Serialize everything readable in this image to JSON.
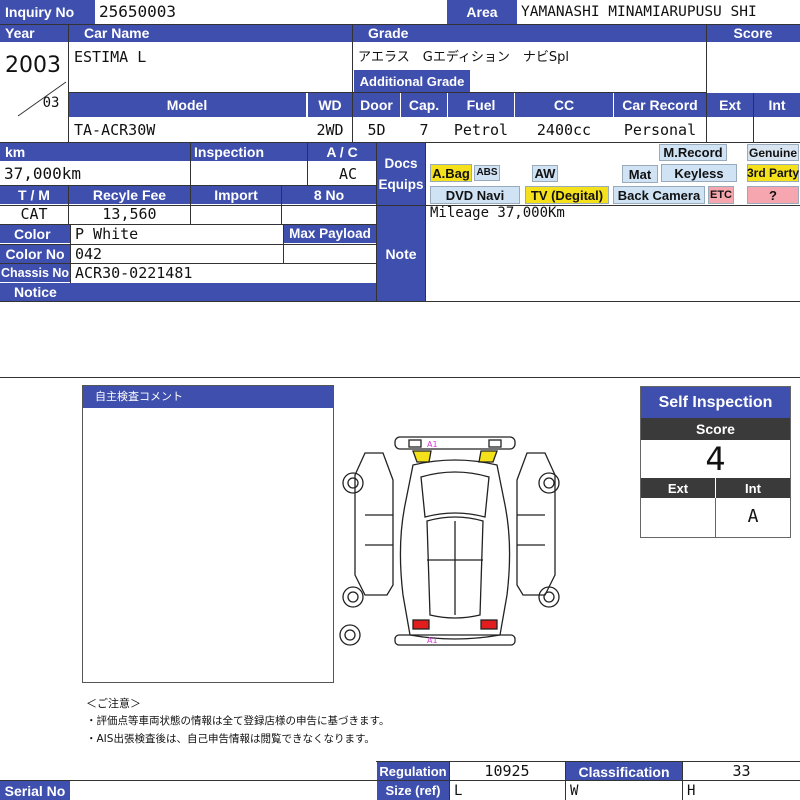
{
  "inquiry": {
    "label": "Inquiry No",
    "value": "25650003"
  },
  "area": {
    "label": "Area",
    "value": "YAMANASHI MINAMIARUPUSU SHI"
  },
  "year": {
    "label": "Year",
    "value": "2003",
    "month": "03"
  },
  "car_name": {
    "label": "Car Name",
    "value": "ESTIMA L"
  },
  "grade": {
    "label": "Grade",
    "value": "アエラス　Gエディション　ナビSpl",
    "additional_label": "Additional Grade",
    "additional_value": ""
  },
  "score_header": {
    "label": "Score"
  },
  "model": {
    "label": "Model",
    "value": "TA-ACR30W"
  },
  "wd": {
    "label": "WD",
    "value": "2WD"
  },
  "door": {
    "label": "Door",
    "value": "5D"
  },
  "cap": {
    "label": "Cap.",
    "value": "7"
  },
  "fuel": {
    "label": "Fuel",
    "value": "Petrol"
  },
  "cc": {
    "label": "CC",
    "value": "2400cc"
  },
  "car_record": {
    "label": "Car Record",
    "value": "Personal"
  },
  "ext_header": {
    "label": "Ext",
    "value": ""
  },
  "int_header": {
    "label": "Int",
    "value": ""
  },
  "km": {
    "label": "km",
    "value": "37,000km"
  },
  "inspection": {
    "label": "Inspection",
    "value": ""
  },
  "ac": {
    "label": "A / C",
    "value": "AC"
  },
  "docs": {
    "label_1": "Docs",
    "label_2": "Equips"
  },
  "equips": {
    "abag": "A.Bag",
    "abs": "ABS",
    "aw": "AW",
    "mrecord": "M.Record",
    "genuine": "Genuine",
    "mat": "Mat",
    "keyless": "Keyless",
    "third_party": "3rd Party",
    "dvd_navi": "DVD Navi",
    "tv": "TV (Degital)",
    "back_camera": "Back Camera",
    "etc": "ETC",
    "question": "?"
  },
  "tm": {
    "label": "T / M",
    "value": "CAT"
  },
  "recycle": {
    "label": "Recyle Fee",
    "value": "13,560"
  },
  "import": {
    "label": "Import",
    "value": ""
  },
  "no8": {
    "label": "8 No",
    "value": ""
  },
  "color": {
    "label": "Color",
    "value": "P White"
  },
  "max_payload": {
    "label": "Max Payload",
    "value": ""
  },
  "color_no": {
    "label": "Color No",
    "value": "042"
  },
  "chassis": {
    "label": "Chassis No",
    "value": "ACR30-0221481"
  },
  "notice": {
    "label": "Notice",
    "value": ""
  },
  "note": {
    "label": "Note",
    "value": "Mileage 37,000Km"
  },
  "comment_box": {
    "title": "自主検査コメント"
  },
  "diagram": {
    "marks": [
      "A1",
      "A1"
    ],
    "mark_color": "#d63ad6"
  },
  "self_inspection": {
    "title": "Self Inspection",
    "score_label": "Score",
    "score_value": "4",
    "ext_label": "Ext",
    "int_label": "Int",
    "ext_value": "",
    "int_value": "A"
  },
  "caution": {
    "title": "＜ご注意＞",
    "lines": [
      "・評価点等車両状態の情報は全て登録店様の申告に基づきます。",
      "・AIS出張検査後は、自己申告情報は閲覧できなくなります。"
    ]
  },
  "regulation": {
    "label": "Regulation",
    "value": "10925"
  },
  "classification": {
    "label": "Classification",
    "value": "33"
  },
  "size": {
    "label": "Size (ref)",
    "l": "L",
    "w": "W",
    "h": "H"
  },
  "serial": {
    "label": "Serial No",
    "value": ""
  },
  "colors": {
    "header": "#3f4fad",
    "chip_blue": "#cfe3f4",
    "chip_yellow": "#f4e11c",
    "chip_pink": "#f6a6ae"
  }
}
